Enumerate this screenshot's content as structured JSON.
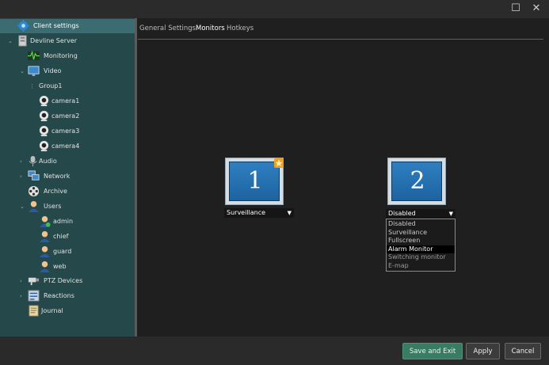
{
  "window": {
    "maximize_icon": "maximize-icon",
    "close_icon": "close-icon"
  },
  "sidebar": {
    "items": [
      {
        "label": "Client settings",
        "icon": "gear-icon"
      },
      {
        "label": "Devline Server",
        "icon": "server-icon"
      },
      {
        "label": "Monitoring",
        "icon": "waveform-icon"
      },
      {
        "label": "Video",
        "icon": "monitor-icon"
      },
      {
        "label": "Group1",
        "icon": ""
      },
      {
        "label": "camera1",
        "icon": "webcam-icon"
      },
      {
        "label": "camera2",
        "icon": "webcam-icon"
      },
      {
        "label": "camera3",
        "icon": "webcam-icon"
      },
      {
        "label": "camera4",
        "icon": "webcam-icon"
      },
      {
        "label": "Audio",
        "icon": "microphone-icon"
      },
      {
        "label": "Network",
        "icon": "network-icon"
      },
      {
        "label": "Archive",
        "icon": "film-reel-icon"
      },
      {
        "label": "Users",
        "icon": "user-icon"
      },
      {
        "label": "admin",
        "icon": "admin-user-icon"
      },
      {
        "label": "chief",
        "icon": "user-icon"
      },
      {
        "label": "guard",
        "icon": "user-icon"
      },
      {
        "label": "web",
        "icon": "user-icon"
      },
      {
        "label": "PTZ Devices",
        "icon": "ptz-camera-icon"
      },
      {
        "label": "Reactions",
        "icon": "reactions-icon"
      },
      {
        "label": "Journal",
        "icon": "journal-icon"
      }
    ]
  },
  "tabs": [
    {
      "label": "General Settings"
    },
    {
      "label": "Monitors"
    },
    {
      "label": "Hotkeys"
    }
  ],
  "active_tab": "Monitors",
  "monitors": [
    {
      "number": "1",
      "mode": "Surveillance",
      "badge": "primary-star-icon"
    },
    {
      "number": "2",
      "mode": "Disabled"
    }
  ],
  "dropdown_options": [
    {
      "label": "Disabled"
    },
    {
      "label": "Surveillance"
    },
    {
      "label": "Fullscreen"
    },
    {
      "label": "Alarm Monitor"
    },
    {
      "label": "Switching monitor"
    },
    {
      "label": "E-map"
    }
  ],
  "dropdown_selected": "Alarm Monitor",
  "buttons": {
    "save_exit": "Save and Exit",
    "apply": "Apply",
    "cancel": "Cancel"
  },
  "colors": {
    "sidebar_bg": "#25484b",
    "sidebar_selected": "#3a6c71",
    "save_button": "#3a7b63",
    "screen_blue": "#2f7fc0"
  }
}
